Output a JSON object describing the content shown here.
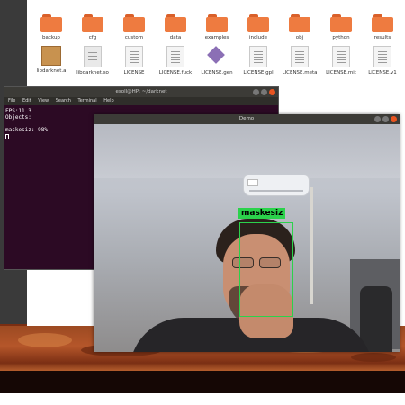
{
  "file_manager": {
    "items": [
      {
        "name": "backup",
        "type": "folder"
      },
      {
        "name": "cfg",
        "type": "folder"
      },
      {
        "name": "custom",
        "type": "folder"
      },
      {
        "name": "data",
        "type": "folder"
      },
      {
        "name": "examples",
        "type": "folder"
      },
      {
        "name": "include",
        "type": "folder"
      },
      {
        "name": "obj",
        "type": "folder"
      },
      {
        "name": "python",
        "type": "folder"
      },
      {
        "name": "results",
        "type": "folder"
      },
      {
        "name": "libdarknet.a",
        "type": "archive"
      },
      {
        "name": "libdarknet.so",
        "type": "library"
      },
      {
        "name": "LICENSE",
        "type": "text"
      },
      {
        "name": "LICENSE.fuck",
        "type": "text"
      },
      {
        "name": "LICENSE.gen",
        "type": "special"
      },
      {
        "name": "LICENSE.gpl",
        "type": "text"
      },
      {
        "name": "LICENSE.meta",
        "type": "text"
      },
      {
        "name": "LICENSE.mit",
        "type": "text"
      },
      {
        "name": "LICENSE.v1",
        "type": "text"
      }
    ]
  },
  "terminal": {
    "title": "esoll@HP: ~/darknet",
    "menu": [
      "File",
      "Edit",
      "View",
      "Search",
      "Terminal",
      "Help"
    ],
    "lines": [
      "FPS:11.3",
      "Objects:",
      "",
      "maskesiz: 98%"
    ]
  },
  "demo": {
    "title": "Demo",
    "detection_label": "maskesiz"
  },
  "colors": {
    "folder": "#ee7b40",
    "terminal_bg": "#2c0a24",
    "detection": "#2bd24b",
    "close_button": "#e95420"
  }
}
